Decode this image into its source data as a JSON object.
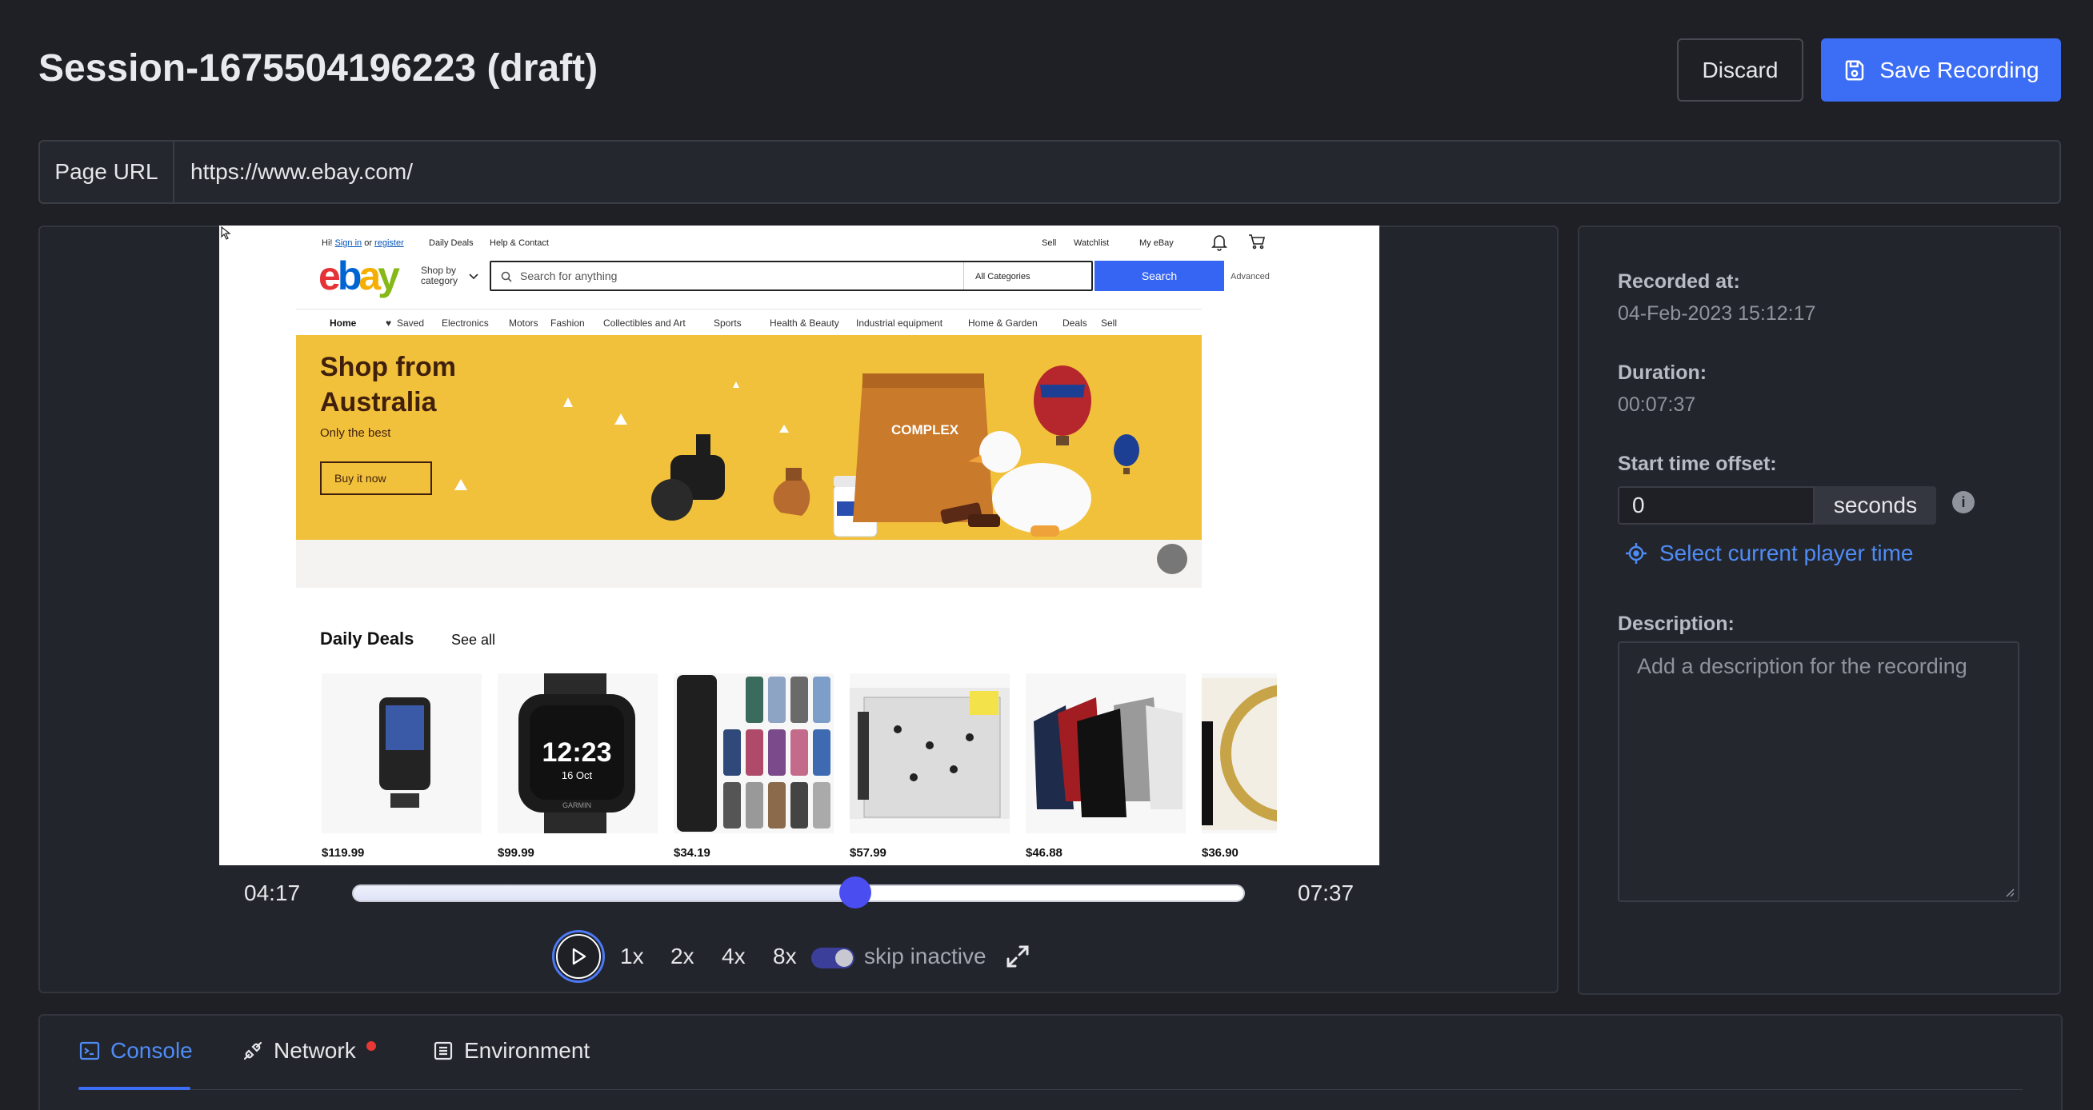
{
  "header": {
    "title": "Session-1675504196223 (draft)",
    "discard_label": "Discard",
    "save_label": "Save Recording"
  },
  "url_bar": {
    "label": "Page URL",
    "value": "https://www.ebay.com/"
  },
  "recorded_page": {
    "top_bar": {
      "greeting": "Hi! ",
      "sign_in": "Sign in",
      "or": " or ",
      "register": "register",
      "daily_deals": "Daily Deals",
      "help": "Help & Contact",
      "sell": "Sell",
      "watchlist": "Watchlist",
      "my_ebay": "My eBay"
    },
    "logo": {
      "e": "e",
      "b": "b",
      "a": "a",
      "y": "y"
    },
    "shop_by": {
      "line1": "Shop by",
      "line2": "category"
    },
    "search": {
      "placeholder": "Search for anything",
      "category": "All Categories",
      "button": "Search",
      "advanced": "Advanced"
    },
    "nav": [
      "Home",
      "Saved",
      "Electronics",
      "Motors",
      "Fashion",
      "Collectibles and Art",
      "Sports",
      "Health & Beauty",
      "Industrial equipment",
      "Home & Garden",
      "Deals",
      "Sell"
    ],
    "banner": {
      "title_line1": "Shop from",
      "title_line2": "Australia",
      "subtitle": "Only the best",
      "button": "Buy it now",
      "product_text": "COMPLEX"
    },
    "deals": {
      "heading": "Daily Deals",
      "see_all": "See all",
      "prices": [
        "$119.99",
        "$99.99",
        "$34.19",
        "$57.99",
        "$46.88",
        "$36.90"
      ],
      "watch_time": "12:23",
      "watch_date": "16 Oct",
      "watch_brand": "GARMIN"
    }
  },
  "player": {
    "current_time": "04:17",
    "total_time": "07:37",
    "progress": 0.564,
    "speeds": [
      "1x",
      "2x",
      "4x",
      "8x"
    ],
    "skip_label": "skip inactive",
    "skip_enabled": true
  },
  "details": {
    "recorded_at_label": "Recorded at:",
    "recorded_at_value": "04-Feb-2023 15:12:17",
    "duration_label": "Duration:",
    "duration_value": "00:07:37",
    "offset_label": "Start time offset:",
    "offset_value": "0",
    "offset_unit": "seconds",
    "info_icon": "i",
    "select_time_label": "Select current player time",
    "description_label": "Description:",
    "description_placeholder": "Add a description for the recording"
  },
  "tabs": [
    {
      "label": "Console",
      "icon": "terminal-icon",
      "active": true
    },
    {
      "label": "Network",
      "icon": "plug-icon",
      "active": false,
      "alert": true
    },
    {
      "label": "Environment",
      "icon": "list-icon",
      "active": false
    }
  ],
  "colors": {
    "accent": "#3c6df5",
    "link": "#4f8cf6",
    "background": "#1e2026",
    "thumb": "#4a4ef0",
    "alert": "#e53935"
  }
}
